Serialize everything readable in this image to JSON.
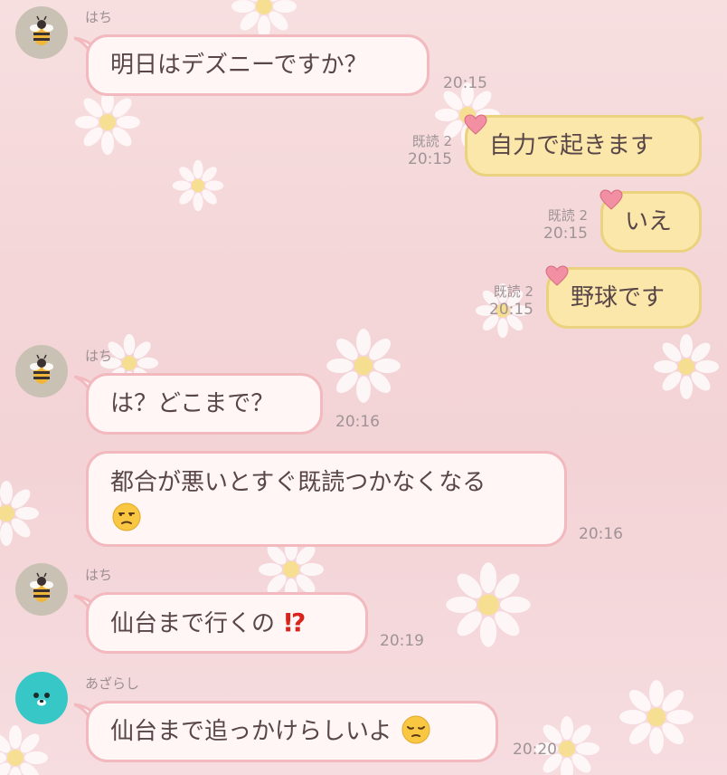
{
  "chat": {
    "messages": [
      {
        "sender": "はち",
        "text": "明日はデズニーですか？",
        "time": "20:15"
      },
      {
        "text": "自力で起きます",
        "read": "既読 2",
        "time": "20:15"
      },
      {
        "text": "いえ",
        "read": "既読 2",
        "time": "20:15"
      },
      {
        "text": "野球です",
        "read": "既読 2",
        "time": "20:15"
      },
      {
        "sender": "はち",
        "text": "は？どこまで？",
        "time": "20:16"
      },
      {
        "text_line1": "都合が悪いとすぐ既読つかなくなる",
        "time": "20:16",
        "emoji": "unamused-face-emoji"
      },
      {
        "sender": "はち",
        "text": "仙台まで行くの",
        "time": "20:19",
        "emoji": "exclamation-question-mark-emoji"
      },
      {
        "sender": "あざらし",
        "text": "仙台まで追っかけらしいよ",
        "time": "20:20",
        "emoji": "pensive-face-emoji"
      }
    ]
  },
  "theme": {
    "incoming_bubble": "#fff6f5",
    "incoming_border": "#f2b9bf",
    "outgoing_bubble": "#fbe7a9",
    "outgoing_border": "#ebd27e",
    "bee_avatar": "#c9c2b4",
    "seal_avatar": "#37c7c7",
    "heart": "#f38fa3"
  }
}
